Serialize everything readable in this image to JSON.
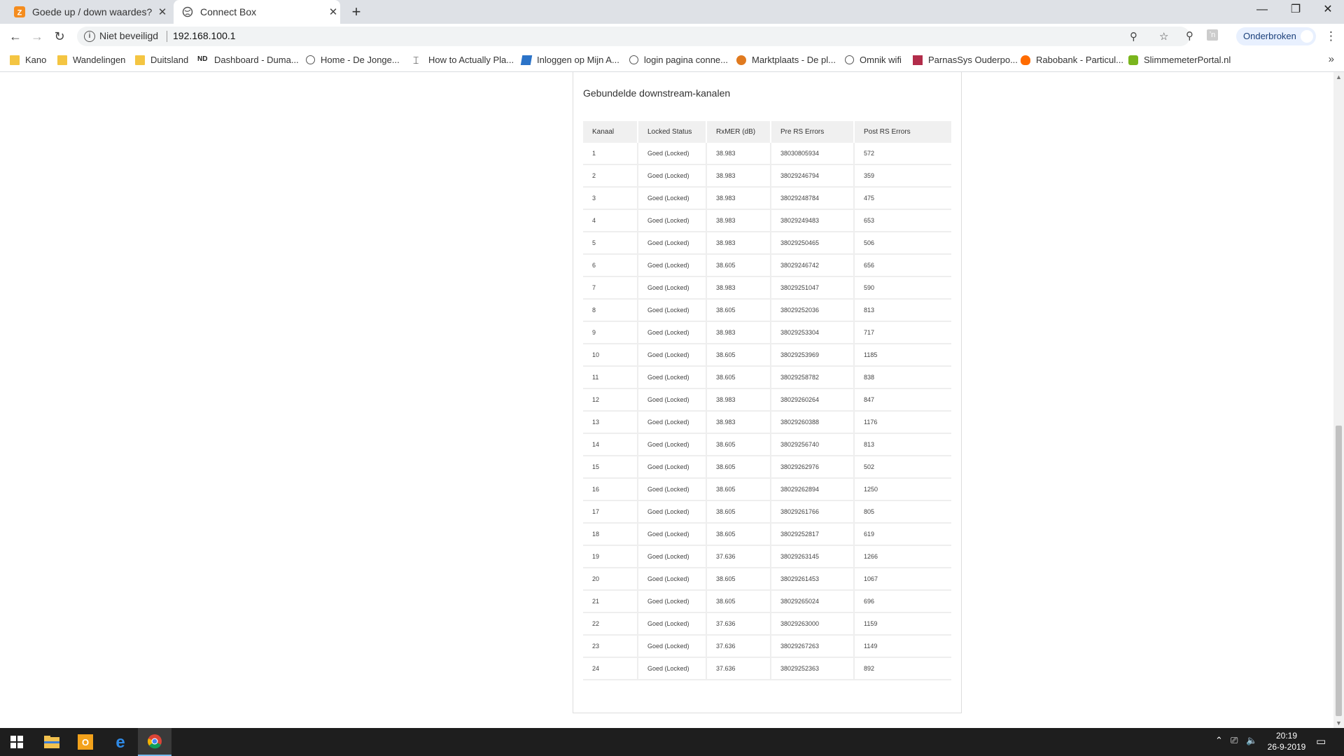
{
  "browser": {
    "tabs": [
      {
        "title": "Goede up / down waardes? | Ziggo",
        "favicon": "ziggo-icon"
      },
      {
        "title": "Connect Box",
        "favicon": "globe-icon"
      }
    ],
    "address": {
      "security_label": "Niet beveiligd",
      "url": "192.168.100.1"
    },
    "profile_label": "Onderbroken"
  },
  "bookmarks": [
    {
      "label": "Kano",
      "icon": "folder-icon"
    },
    {
      "label": "Wandelingen",
      "icon": "folder-icon"
    },
    {
      "label": "Duitsland",
      "icon": "folder-icon"
    },
    {
      "label": "Dashboard - Duma...",
      "icon": "nd-icon"
    },
    {
      "label": "Home - De Jonge...",
      "icon": "globe-icon"
    },
    {
      "label": "How to Actually Pla...",
      "icon": "anchor-icon"
    },
    {
      "label": "Inloggen op Mijn A...",
      "icon": "blue-square-icon"
    },
    {
      "label": "login pagina conne...",
      "icon": "globe-icon"
    },
    {
      "label": "Marktplaats - De pl...",
      "icon": "marktplaats-icon"
    },
    {
      "label": "Omnik wifi",
      "icon": "globe-icon"
    },
    {
      "label": "ParnasSys Ouderpo...",
      "icon": "parnassys-icon"
    },
    {
      "label": "Rabobank - Particul...",
      "icon": "rabobank-icon"
    },
    {
      "label": "SlimmemeterPortal.nl",
      "icon": "slimmemeter-icon"
    }
  ],
  "panel": {
    "title": "Gebundelde downstream-kanalen",
    "headers": [
      "Kanaal",
      "Locked Status",
      "RxMER (dB)",
      "Pre RS Errors",
      "Post RS Errors"
    ],
    "rows": [
      [
        "1",
        "Goed (Locked)",
        "38.983",
        "38030805934",
        "572"
      ],
      [
        "2",
        "Goed (Locked)",
        "38.983",
        "38029246794",
        "359"
      ],
      [
        "3",
        "Goed (Locked)",
        "38.983",
        "38029248784",
        "475"
      ],
      [
        "4",
        "Goed (Locked)",
        "38.983",
        "38029249483",
        "653"
      ],
      [
        "5",
        "Goed (Locked)",
        "38.983",
        "38029250465",
        "506"
      ],
      [
        "6",
        "Goed (Locked)",
        "38.605",
        "38029246742",
        "656"
      ],
      [
        "7",
        "Goed (Locked)",
        "38.983",
        "38029251047",
        "590"
      ],
      [
        "8",
        "Goed (Locked)",
        "38.605",
        "38029252036",
        "813"
      ],
      [
        "9",
        "Goed (Locked)",
        "38.983",
        "38029253304",
        "717"
      ],
      [
        "10",
        "Goed (Locked)",
        "38.605",
        "38029253969",
        "1185"
      ],
      [
        "11",
        "Goed (Locked)",
        "38.605",
        "38029258782",
        "838"
      ],
      [
        "12",
        "Goed (Locked)",
        "38.983",
        "38029260264",
        "847"
      ],
      [
        "13",
        "Goed (Locked)",
        "38.983",
        "38029260388",
        "1176"
      ],
      [
        "14",
        "Goed (Locked)",
        "38.605",
        "38029256740",
        "813"
      ],
      [
        "15",
        "Goed (Locked)",
        "38.605",
        "38029262976",
        "502"
      ],
      [
        "16",
        "Goed (Locked)",
        "38.605",
        "38029262894",
        "1250"
      ],
      [
        "17",
        "Goed (Locked)",
        "38.605",
        "38029261766",
        "805"
      ],
      [
        "18",
        "Goed (Locked)",
        "38.605",
        "38029252817",
        "619"
      ],
      [
        "19",
        "Goed (Locked)",
        "37.636",
        "38029263145",
        "1266"
      ],
      [
        "20",
        "Goed (Locked)",
        "38.605",
        "38029261453",
        "1067"
      ],
      [
        "21",
        "Goed (Locked)",
        "38.605",
        "38029265024",
        "696"
      ],
      [
        "22",
        "Goed (Locked)",
        "37.636",
        "38029263000",
        "1159"
      ],
      [
        "23",
        "Goed (Locked)",
        "37.636",
        "38029267263",
        "1149"
      ],
      [
        "24",
        "Goed (Locked)",
        "37.636",
        "38029252363",
        "892"
      ]
    ]
  },
  "taskbar": {
    "apps": [
      "windows-start-icon",
      "file-explorer-icon",
      "outlook-icon",
      "edge-icon",
      "chrome-icon"
    ],
    "time": "20:19",
    "date": "26-9-2019"
  },
  "colors": {
    "tabstrip": "#dee1e6",
    "taskbar": "#1e1e1e",
    "profile_bg": "#e8f0fe"
  }
}
